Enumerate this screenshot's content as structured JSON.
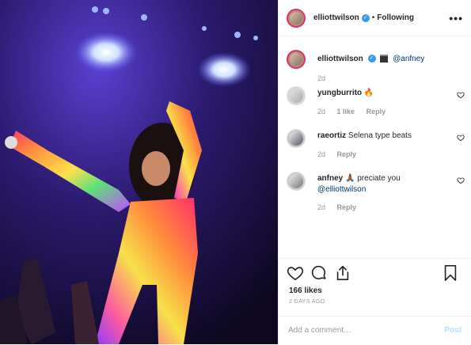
{
  "header": {
    "username": "elliottwilson",
    "separator": "•",
    "follow_status": "Following",
    "more": "•••"
  },
  "caption": {
    "username": "elliottwilson",
    "mention": "@anfney",
    "time": "2d"
  },
  "comments": [
    {
      "username": "yungburrito",
      "text": "🔥",
      "time": "2d",
      "likes": "1 like",
      "reply": "Reply"
    },
    {
      "username": "raeortiz",
      "text": "Selena type beats",
      "time": "2d",
      "likes": "",
      "reply": "Reply"
    },
    {
      "username": "anfney",
      "text": "🙏🏾 preciate you",
      "mention": "@elliottwilson",
      "time": "2d",
      "likes": "",
      "reply": "Reply"
    }
  ],
  "stats": {
    "likes": "166 likes",
    "date": "2 DAYS AGO"
  },
  "add_comment": {
    "placeholder": "Add a comment…",
    "post_label": "Post"
  },
  "colors": {
    "verified": "#3897f0",
    "post_disabled": "#b2dffc",
    "story_ring": "#e1306c"
  }
}
